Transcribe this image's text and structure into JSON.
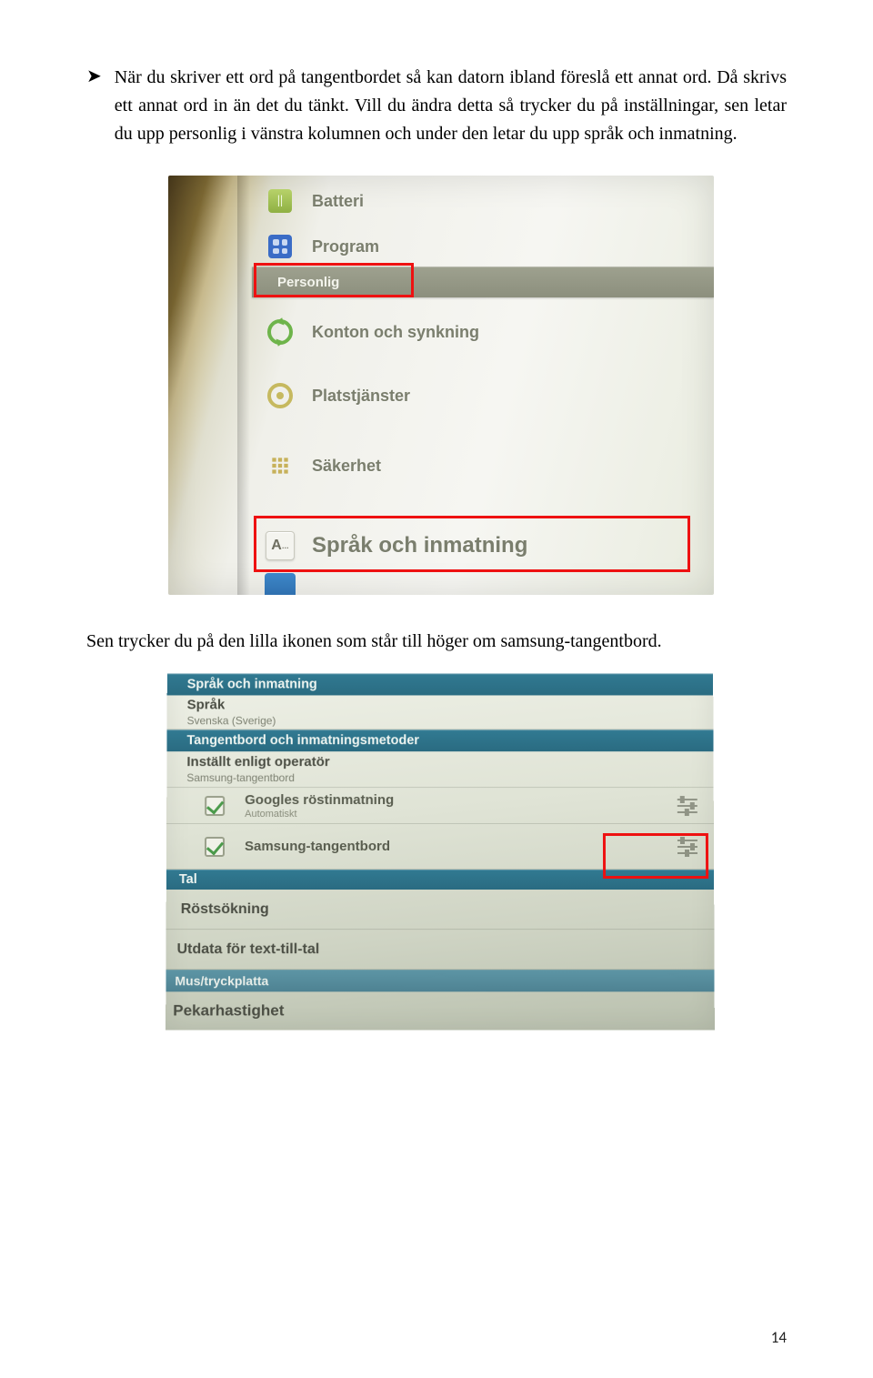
{
  "para1": "När du skriver ett ord på tangentbordet så kan datorn ibland föreslå ett annat ord. Då skrivs ett annat ord in än det du tänkt. Vill du ändra detta så trycker du på inställningar, sen letar du upp personlig i vänstra kolumnen och under den letar du upp språk och inmatning.",
  "bullet_glyph": "➤",
  "photo1": {
    "rows": {
      "batteri": "Batteri",
      "program": "Program",
      "header_personlig": "Personlig",
      "konton": "Konton och synkning",
      "plats": "Platstjänster",
      "sakerhet": "Säkerhet",
      "sprak": "Språk och inmatning"
    }
  },
  "para2": "Sen trycker du på den lilla ikonen som står till höger om samsung-tangentbord.",
  "photo2": {
    "band1": "Språk och inmatning",
    "r1_title": "Språk",
    "r1_sub": "Svenska (Sverige)",
    "band2": "Tangentbord och inmatningsmetoder",
    "r2_title": "Inställt enligt operatör",
    "r2_sub": "Samsung-tangentbord",
    "r3_title": "Googles röstinmatning",
    "r3_sub": "Automatiskt",
    "r4_title": "Samsung-tangentbord",
    "band3": "Tal",
    "r5": "Röstsökning",
    "r6": "Utdata för text-till-tal",
    "band4": "Mus/tryckplatta",
    "r7": "Pekarhastighet"
  },
  "page_number": "14"
}
